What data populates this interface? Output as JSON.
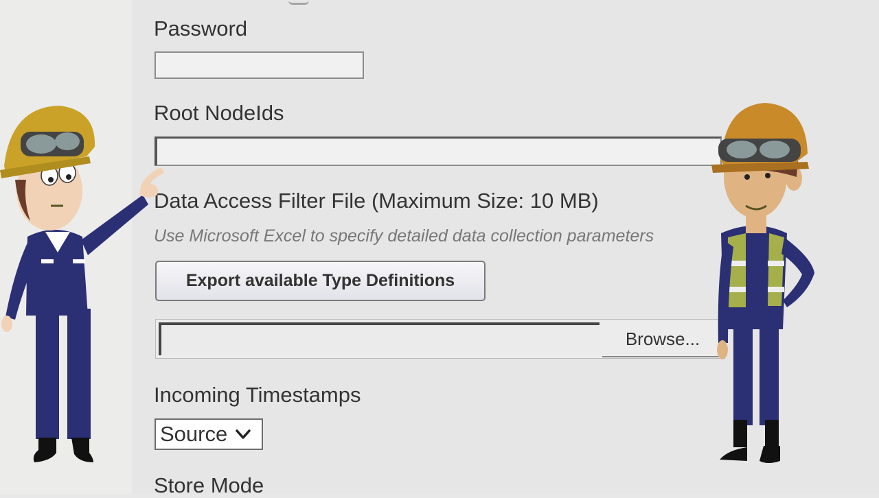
{
  "form": {
    "password_label": "Password",
    "password_value": "",
    "root_nodeids_label": "Root NodeIds",
    "root_nodeids_value": "",
    "filter_file_label": "Data Access Filter File (Maximum Size: 10 MB)",
    "filter_file_note": "Use Microsoft Excel to specify detailed data collection parameters",
    "export_button_label": "Export available Type Definitions",
    "browse_button_label": "Browse...",
    "incoming_timestamps_label": "Incoming Timestamps",
    "incoming_timestamps_value": "Source",
    "store_mode_label": "Store Mode"
  },
  "icons": {
    "select_chevron": "chevron-down-icon"
  },
  "colors": {
    "background": "#e6e6e6",
    "text": "#333333",
    "note_text": "#777777",
    "worker_uniform": "#2b2f74",
    "hard_hat": "#c9a227",
    "safety_vest": "#a6b04a"
  }
}
